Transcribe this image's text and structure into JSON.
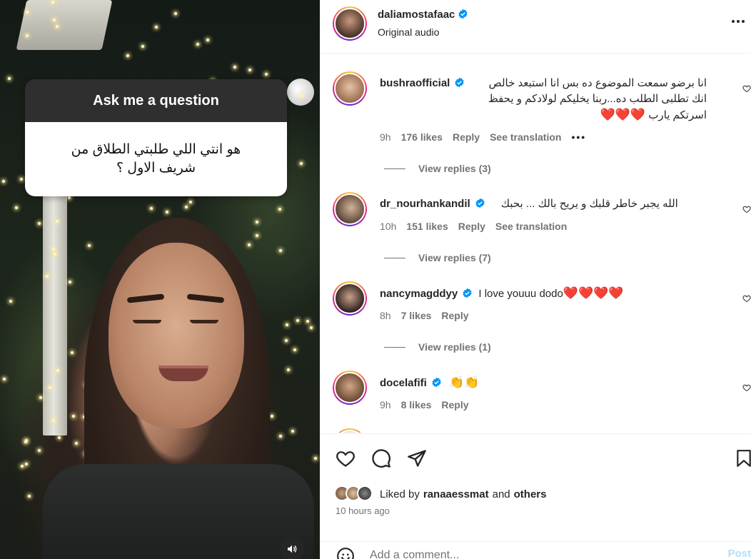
{
  "media": {
    "question_title": "Ask me a question",
    "question_text": "هو انتي اللي طلبتي الطلاق من شريف الاول ؟"
  },
  "header": {
    "username": "daliamostafaac",
    "subtitle": "Original audio"
  },
  "comments": [
    {
      "username": "bushraofficial",
      "text": "انا برضو سمعت الموضوع ده بس انا استبعد خالص انك تطلبى الطلب ده...ربنا يخليكم لولادكم و يحفظ اسرتكم يارب",
      "emoji": "❤️❤️❤️",
      "time": "9h",
      "likes": "176 likes",
      "reply": "Reply",
      "translation": "See translation",
      "more": "•••",
      "view_replies": "View replies (3)"
    },
    {
      "username": "dr_nourhankandil",
      "text": "الله يجبر خاطر قلبك و يريح بالك ... بحبك",
      "time": "10h",
      "likes": "151 likes",
      "reply": "Reply",
      "translation": "See translation",
      "view_replies": "View replies (7)"
    },
    {
      "username": "nancymagddyy",
      "text": "I love youuu dodo",
      "emoji": "❤️❤️❤️❤️",
      "time": "8h",
      "likes": "7 likes",
      "reply": "Reply",
      "view_replies": "View replies (1)"
    },
    {
      "username": "docelafifi",
      "text": "",
      "emoji": "👏👏",
      "time": "9h",
      "likes": "8 likes",
      "reply": "Reply"
    }
  ],
  "footer": {
    "liked_by_prefix": "Liked by",
    "liked_by_user": "ranaaessmat",
    "and": "and",
    "others": "others",
    "time_ago": "10 hours ago",
    "comment_placeholder": "Add a comment...",
    "post_label": "Post"
  },
  "colors": {
    "verified_blue": "#0095f6",
    "heart_red": "#e0142b",
    "muted_text": "#737373"
  }
}
